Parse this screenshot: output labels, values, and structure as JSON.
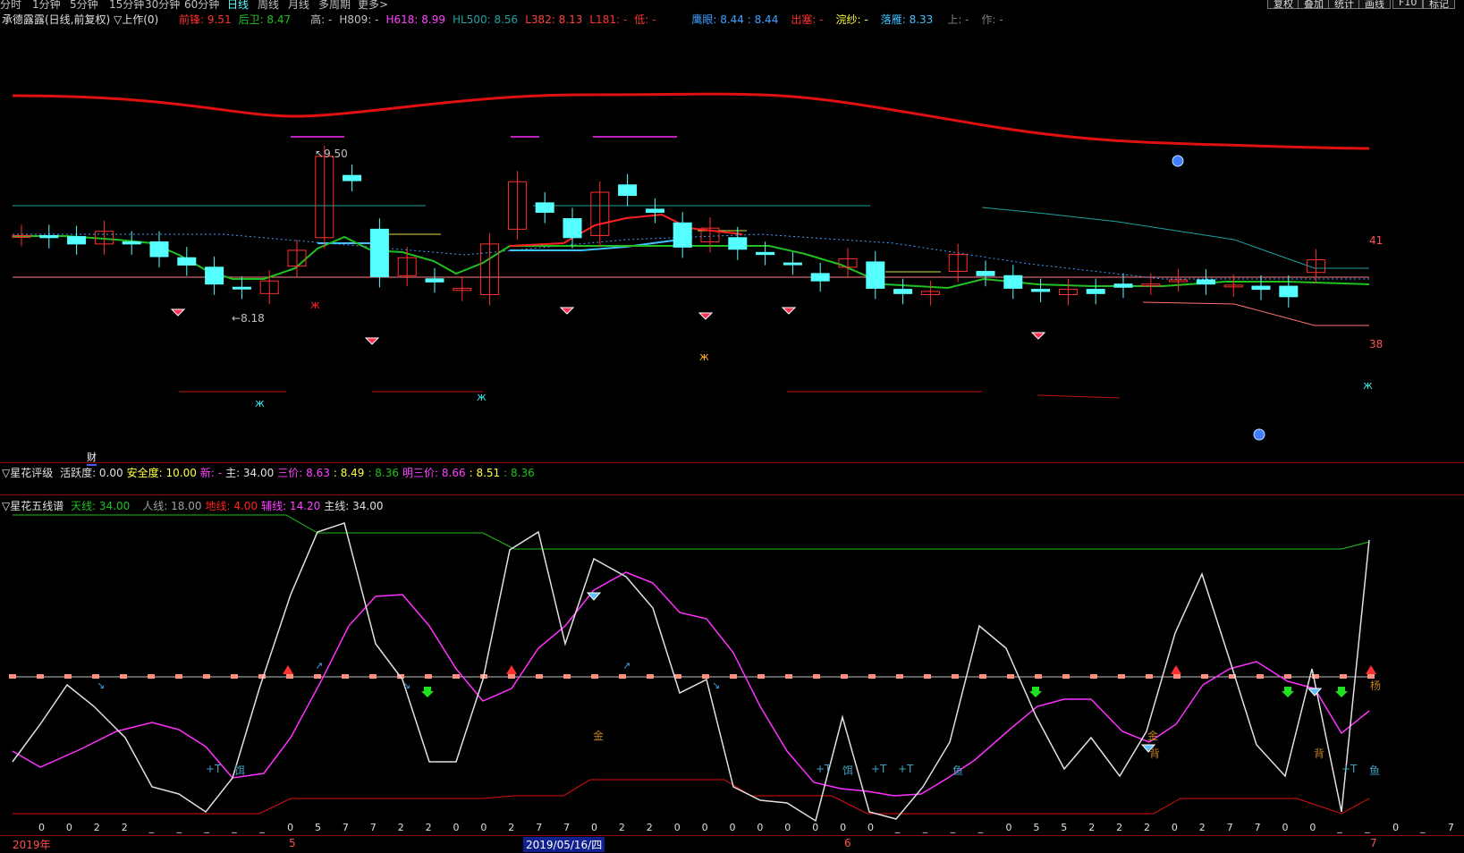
{
  "top_periods": [
    "分时",
    "1分钟",
    "5分钟",
    "15分钟",
    "30分钟",
    "60分钟",
    "日线",
    "周线",
    "月线",
    "多周期",
    "更多>"
  ],
  "active_period": "日线",
  "top_buttons": [
    "复权",
    "叠加",
    "统计",
    "画线",
    "F10",
    "标记"
  ],
  "main_header": {
    "stock": "承德露露(日线,前复权) ▽上作(0)",
    "fields": [
      {
        "text": "前锋: 9.51",
        "color": "#ff3030"
      },
      {
        "text": "后卫: 8.47",
        "color": "#20c020"
      },
      {
        "text": "高: -",
        "color": "#c0c0c0"
      },
      {
        "text": "H809: -",
        "color": "#c0c0c0"
      },
      {
        "text": "H618: 8.99",
        "color": "#ff40ff"
      },
      {
        "text": "HL500: 8.56",
        "color": "#20a0a0"
      },
      {
        "text": "L382: 8.13",
        "color": "#ff4040"
      },
      {
        "text": "L181: -",
        "color": "#ff3030"
      },
      {
        "text": "低: -",
        "color": "#ff3030"
      },
      {
        "text": "鹰眼: 8.44 : 8.44",
        "color": "#40a0ff"
      },
      {
        "text": "出塞: -",
        "color": "#ff3030"
      },
      {
        "text": "浣纱: -",
        "color": "#ffff40"
      },
      {
        "text": "落雁: 8.33",
        "color": "#40c0ff"
      },
      {
        "text": "上: -",
        "color": "#808080"
      },
      {
        "text": "作: -",
        "color": "#808080"
      }
    ]
  },
  "price_labels": {
    "high": "9.50",
    "low": "8.18",
    "right_top": "41",
    "right_bottom": "38",
    "cai": "财"
  },
  "panel2_header": {
    "title": "▽星花评级",
    "fields": [
      {
        "text": "活跃度: 0.00",
        "color": "#e0e0e0"
      },
      {
        "text": "安全度: 10.00",
        "color": "#ffff40"
      },
      {
        "text": "新: -",
        "color": "#ff40ff"
      },
      {
        "text": "主: 34.00",
        "color": "#e0e0e0"
      },
      {
        "text": "三价: 8.63",
        "color": "#ff40ff"
      },
      {
        "text": ": 8.49",
        "color": "#ffff40"
      },
      {
        "text": ": 8.36",
        "color": "#20c020"
      },
      {
        "text": "明三价: 8.66",
        "color": "#ff40ff"
      },
      {
        "text": ": 8.51",
        "color": "#ffff40"
      },
      {
        "text": ": 8.36",
        "color": "#20c020"
      }
    ]
  },
  "panel3_header": {
    "title": "▽星花五线谱",
    "fields": [
      {
        "text": "天线: 34.00",
        "color": "#20c020"
      },
      {
        "text": "人线: 18.00",
        "color": "#a0a0a0"
      },
      {
        "text": "地线: 4.00",
        "color": "#ff2020"
      },
      {
        "text": "辅线: 14.20",
        "color": "#ff40ff"
      },
      {
        "text": "主线: 34.00",
        "color": "#e0e0e0"
      }
    ]
  },
  "panel3_labels": {
    "jin1": "金",
    "jin2": "金",
    "bei1": "背",
    "bei2": "背",
    "yang": "杨",
    "plusT": [
      "+T",
      "+T",
      "+T",
      "+T",
      "+T"
    ],
    "er1": "饵",
    "er2": "饵",
    "yu1": "鱼",
    "yu2": "鱼"
  },
  "bottom_digits": [
    "0",
    "0",
    "2",
    "2",
    "_",
    "_",
    "_",
    "_",
    "_",
    "0",
    "5",
    "7",
    "7",
    "2",
    "2",
    "0",
    "0",
    "2",
    "7",
    "7",
    "0",
    "2",
    "2",
    "0",
    "0",
    "0",
    "0",
    "0",
    "0",
    "0",
    "0",
    "_",
    "_",
    "_",
    "_",
    "0",
    "5",
    "5",
    "2",
    "2",
    "2",
    "0",
    "2",
    "7",
    "7",
    "0",
    "0",
    "_",
    "_",
    "0",
    "_",
    "7"
  ],
  "date_axis": {
    "year": "2019年",
    "m5": "5",
    "current": "2019/05/16/四",
    "m6": "6",
    "m7": "7"
  },
  "chart_data": {
    "type": "candlestick",
    "candles": [
      {
        "o": 8.44,
        "c": 8.44
      },
      {
        "o": 8.44,
        "c": 8.42
      },
      {
        "o": 8.43,
        "c": 8.36
      },
      {
        "o": 8.36,
        "c": 8.48
      },
      {
        "o": 8.38,
        "c": 8.36
      },
      {
        "o": 8.38,
        "c": 8.24
      },
      {
        "o": 8.23,
        "c": 8.16
      },
      {
        "o": 8.14,
        "c": 7.98
      },
      {
        "o": 7.95,
        "c": 7.94
      },
      {
        "o": 7.89,
        "c": 8.01
      },
      {
        "o": 8.15,
        "c": 8.3
      },
      {
        "o": 8.42,
        "c": 9.19
      },
      {
        "o": 9.01,
        "c": 8.96
      },
      {
        "o": 8.5,
        "c": 8.05
      },
      {
        "o": 8.06,
        "c": 8.23
      },
      {
        "o": 8.03,
        "c": 8.0
      },
      {
        "o": 7.92,
        "c": 7.94
      },
      {
        "o": 7.88,
        "c": 8.36
      },
      {
        "o": 8.5,
        "c": 8.95
      },
      {
        "o": 8.75,
        "c": 8.66
      },
      {
        "o": 8.6,
        "c": 8.42
      },
      {
        "o": 8.44,
        "c": 8.85
      },
      {
        "o": 8.92,
        "c": 8.82
      },
      {
        "o": 8.69,
        "c": 8.66
      },
      {
        "o": 8.56,
        "c": 8.33
      },
      {
        "o": 8.38,
        "c": 8.51
      },
      {
        "o": 8.42,
        "c": 8.31
      },
      {
        "o": 8.28,
        "c": 8.26
      },
      {
        "o": 8.18,
        "c": 8.17
      },
      {
        "o": 8.08,
        "c": 8.01
      },
      {
        "o": 8.14,
        "c": 8.22
      },
      {
        "o": 8.19,
        "c": 7.94
      },
      {
        "o": 7.93,
        "c": 7.89
      },
      {
        "o": 7.88,
        "c": 7.91
      },
      {
        "o": 8.1,
        "c": 8.26
      },
      {
        "o": 8.1,
        "c": 8.06
      },
      {
        "o": 8.06,
        "c": 7.94
      },
      {
        "o": 7.93,
        "c": 7.91
      },
      {
        "o": 7.88,
        "c": 7.93
      },
      {
        "o": 7.93,
        "c": 7.89
      },
      {
        "o": 7.98,
        "c": 7.95
      },
      {
        "o": 7.98,
        "c": 7.98
      },
      {
        "o": 8.01,
        "c": 8.02
      },
      {
        "o": 8.02,
        "c": 7.98
      },
      {
        "o": 7.96,
        "c": 7.97
      },
      {
        "o": 7.96,
        "c": 7.93
      },
      {
        "o": 7.96,
        "c": 7.86
      },
      {
        "o": 8.09,
        "c": 8.21
      }
    ]
  },
  "colors": {
    "up": "#ff3030",
    "down": "#55ffff",
    "grid": "#8b0000",
    "bg": "#000000"
  }
}
